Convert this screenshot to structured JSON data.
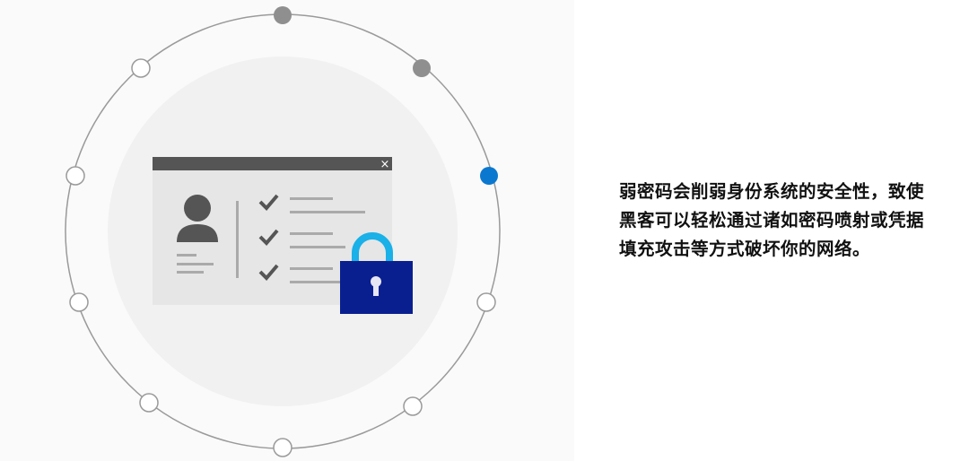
{
  "caption": "弱密码会削弱身份系统的安全性，致使黑客可以轻松通过诸如密码喷射或凭据填充攻击等方式破坏你的网络。",
  "window": {
    "close_icon": "×"
  },
  "colors": {
    "ring": "#9a9a9a",
    "dot_gray": "#8f8f8f",
    "dot_active": "#0b78d0",
    "window_titlebar": "#555555",
    "window_body": "#e6e6e6",
    "lock_body": "#0a1f8f",
    "lock_shackle": "#1ab0e8"
  }
}
